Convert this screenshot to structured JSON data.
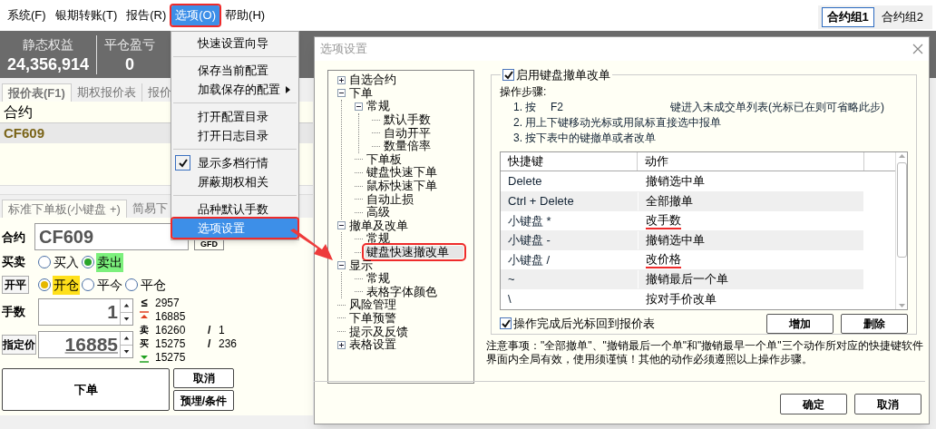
{
  "menu_bar": {
    "items": [
      {
        "label": "系统(F)",
        "selected": false,
        "annotated": false
      },
      {
        "label": "银期转账(T)",
        "selected": false,
        "annotated": false
      },
      {
        "label": "报告(R)",
        "selected": false,
        "annotated": false
      },
      {
        "label": "选项(O)",
        "selected": true,
        "annotated": true
      },
      {
        "label": "帮助(H)",
        "selected": false,
        "annotated": false
      }
    ],
    "groups": [
      {
        "label": "合约组1",
        "selected": true
      },
      {
        "label": "合约组2",
        "selected": false
      }
    ]
  },
  "account_summary": [
    {
      "label": "静态权益",
      "value": "24,356,914"
    },
    {
      "label": "平仓盈亏",
      "value": "0"
    }
  ],
  "quote_tabs": [
    {
      "label": "报价表(F1)",
      "selected": true
    },
    {
      "label": "期权报价表",
      "selected": false
    },
    {
      "label": "报价",
      "selected": false
    }
  ],
  "quote_table": {
    "columns": [
      "合约"
    ],
    "rows": [
      [
        "CF609"
      ]
    ]
  },
  "order_tabs": [
    {
      "label": "标准下单板(小键盘 +)",
      "selected": true
    },
    {
      "label": "简易下",
      "selected": false
    }
  ],
  "order_panel": {
    "contract_label": "合约",
    "contract": "CF609",
    "tif": "GFD",
    "side": {
      "label": "买卖",
      "options": [
        {
          "label": "买入",
          "selected": false
        },
        {
          "label": "卖出",
          "selected": true
        }
      ]
    },
    "offset": {
      "label": "开平",
      "options": [
        {
          "label": "开仓",
          "selected": true
        },
        {
          "label": "平今",
          "selected": false
        },
        {
          "label": "平仓",
          "selected": false
        }
      ]
    },
    "quantity": {
      "label": "手数",
      "value": "1"
    },
    "price": {
      "label": "指定价",
      "value": "16885"
    },
    "quotes": [
      {
        "kind": "limit",
        "mark": "≤",
        "value": "2957"
      },
      {
        "kind": "upper",
        "value": "16885"
      },
      {
        "kind": "ask",
        "mark": "卖",
        "value": "16260",
        "slash": "/",
        "volume": "1"
      },
      {
        "kind": "bid",
        "mark": "买",
        "value": "15275",
        "slash": "/",
        "volume": "236"
      },
      {
        "kind": "lower",
        "value": "15275"
      }
    ],
    "buttons": {
      "submit": "下单",
      "cancel": "取消",
      "conditional": "预埋/条件"
    }
  },
  "options_menu": [
    {
      "kind": "item",
      "label": "快速设置向导",
      "checked": false,
      "selected": false,
      "annotated": false
    },
    {
      "kind": "separator"
    },
    {
      "kind": "item",
      "label": "保存当前配置",
      "checked": false,
      "selected": false,
      "annotated": false
    },
    {
      "kind": "submenu",
      "label": "加载保存的配置",
      "checked": false,
      "selected": false,
      "annotated": false
    },
    {
      "kind": "separator"
    },
    {
      "kind": "item",
      "label": "打开配置目录",
      "checked": false,
      "selected": false,
      "annotated": false
    },
    {
      "kind": "item",
      "label": "打开日志目录",
      "checked": false,
      "selected": false,
      "annotated": false
    },
    {
      "kind": "separator"
    },
    {
      "kind": "item",
      "label": "显示多档行情",
      "checked": true,
      "selected": false,
      "annotated": false
    },
    {
      "kind": "item",
      "label": "屏蔽期权相关",
      "checked": false,
      "selected": false,
      "annotated": false
    },
    {
      "kind": "separator"
    },
    {
      "kind": "item",
      "label": "品种默认手数",
      "checked": false,
      "selected": false,
      "annotated": false
    },
    {
      "kind": "item",
      "label": "选项设置",
      "checked": false,
      "selected": true,
      "annotated": true
    }
  ],
  "dialog": {
    "title": "选项设置",
    "tree": [
      {
        "label": "自选合约",
        "expanded": false,
        "selected": false,
        "annotated": false
      },
      {
        "label": "下单",
        "expanded": true,
        "selected": false,
        "annotated": false,
        "children": [
          {
            "label": "常规",
            "expanded": true,
            "selected": false,
            "annotated": false,
            "children": [
              {
                "label": "默认手数",
                "selected": false,
                "annotated": false
              },
              {
                "label": "自动开平",
                "selected": false,
                "annotated": false
              },
              {
                "label": "数量倍率",
                "selected": false,
                "annotated": false
              }
            ]
          },
          {
            "label": "下单板",
            "selected": false,
            "annotated": false
          },
          {
            "label": "键盘快速下单",
            "selected": false,
            "annotated": false
          },
          {
            "label": "鼠标快速下单",
            "selected": false,
            "annotated": false
          },
          {
            "label": "自动止损",
            "selected": false,
            "annotated": false
          },
          {
            "label": "高级",
            "selected": false,
            "annotated": false
          }
        ]
      },
      {
        "label": "撤单及改单",
        "expanded": true,
        "selected": false,
        "annotated": false,
        "children": [
          {
            "label": "常规",
            "selected": false,
            "annotated": false
          },
          {
            "label": "键盘快速撤改单",
            "selected": true,
            "annotated": true
          }
        ]
      },
      {
        "label": "显示",
        "expanded": true,
        "selected": false,
        "annotated": false,
        "children": [
          {
            "label": "常规",
            "selected": false,
            "annotated": false
          },
          {
            "label": "表格字体颜色",
            "selected": false,
            "annotated": false
          }
        ]
      },
      {
        "label": "风险管理",
        "selected": false,
        "annotated": false
      },
      {
        "label": "下单预警",
        "selected": false,
        "annotated": false
      },
      {
        "label": "提示及反馈",
        "selected": false,
        "annotated": false
      },
      {
        "label": "表格设置",
        "expanded": false,
        "selected": false,
        "annotated": false
      }
    ],
    "enable": {
      "label": "启用键盘撤单改单",
      "checked": true
    },
    "steps_label": "操作步骤:",
    "steps": [
      {
        "number": "1.",
        "parts": [
          "按",
          "F2",
          "键进入未成交单列表(光标已在则可省略此步)"
        ]
      },
      {
        "number": "2.",
        "parts": [
          "用上下键移动光标或用鼠标直接选中报单"
        ]
      },
      {
        "number": "3.",
        "parts": [
          "按下表中的键撤单或者改单"
        ]
      }
    ],
    "table": {
      "columns": [
        "快捷键",
        "动作"
      ],
      "rows": [
        {
          "key": "Delete",
          "action": "撤销选中单",
          "underlined": false
        },
        {
          "key": "Ctrl + Delete",
          "action": "全部撤单",
          "underlined": false
        },
        {
          "key": "小键盘 *",
          "action": "改手数",
          "underlined": true
        },
        {
          "key": "小键盘 -",
          "action": "撤销选中单",
          "underlined": false
        },
        {
          "key": "小键盘 /",
          "action": "改价格",
          "underlined": true
        },
        {
          "key": "~",
          "action": "撤销最后一个单",
          "underlined": false
        },
        {
          "key": "\\",
          "action": "按对手价改单",
          "underlined": false
        }
      ]
    },
    "return_to_quotes": {
      "label": "操作完成后光标回到报价表",
      "checked": true
    },
    "add_button": "增加",
    "delete_button": "删除",
    "note": "注意事项：\"全部撤单\"、\"撤销最后一个单\"和\"撤销最早一个单\"三个动作所对应的快捷键软件界面内全局有效，使用须谨慎！其他的动作必须遵照以上操作步骤。",
    "ok_button": "确定",
    "cancel_button": "取消"
  }
}
